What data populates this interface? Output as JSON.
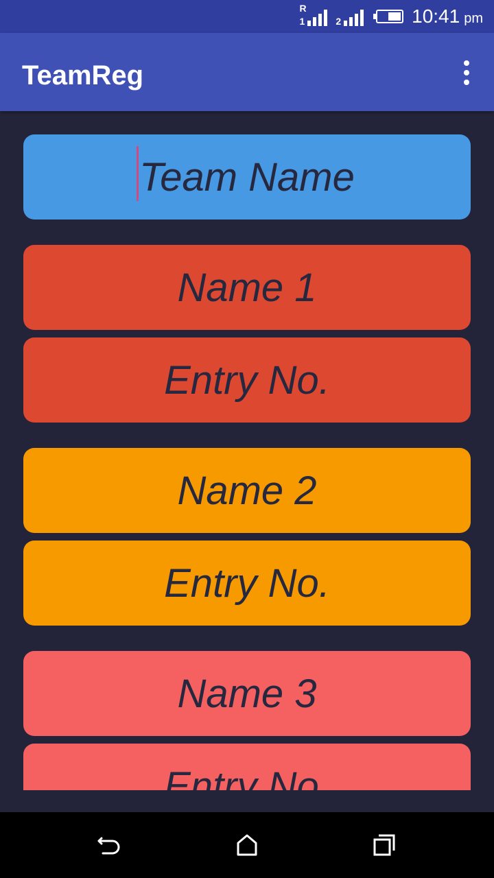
{
  "status_bar": {
    "roaming_label": "R",
    "sim1_label": "1",
    "sim2_label": "2",
    "time": "10:41",
    "ampm": "pm",
    "signal_icon": "signal-icon",
    "battery_icon": "battery-icon"
  },
  "app_bar": {
    "title": "TeamReg",
    "menu_icon": "more-vert-icon"
  },
  "form": {
    "team_name_placeholder": "Team Name",
    "members": [
      {
        "name_placeholder": "Name 1",
        "entry_placeholder": "Entry No.",
        "color": "#dd4831"
      },
      {
        "name_placeholder": "Name 2",
        "entry_placeholder": "Entry No.",
        "color": "#f69a00"
      },
      {
        "name_placeholder": "Name 3",
        "entry_placeholder": "Entry No.",
        "color": "#f56061"
      }
    ],
    "team_color": "#4699e2",
    "text_color": "#26283f",
    "cursor_color": "#d44a7e"
  },
  "colors": {
    "background": "#23243a",
    "status_bar": "#303f9f",
    "app_bar": "#3f51b5",
    "nav_bar": "#000000"
  },
  "nav_bar": {
    "back_icon": "back-icon",
    "home_icon": "home-icon",
    "recents_icon": "recents-icon"
  }
}
